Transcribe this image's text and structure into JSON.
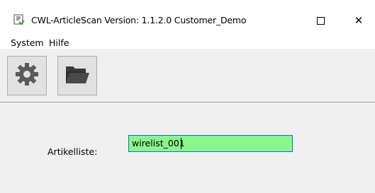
{
  "window": {
    "title": "CWL-ArticleScan  Version: 1.1.2.0  Customer_Demo",
    "maximize_icon": "maximize-icon",
    "close_label": "✕"
  },
  "menu": {
    "items": [
      "System",
      "Hilfe"
    ]
  },
  "toolbar": {
    "buttons": [
      {
        "icon": "gear-icon"
      },
      {
        "icon": "folder-open-icon"
      }
    ]
  },
  "form": {
    "label": "Artikelliste:",
    "value": "wirelist_001",
    "field_color": "#8cf58c",
    "focus_border_color": "#0078d7"
  }
}
